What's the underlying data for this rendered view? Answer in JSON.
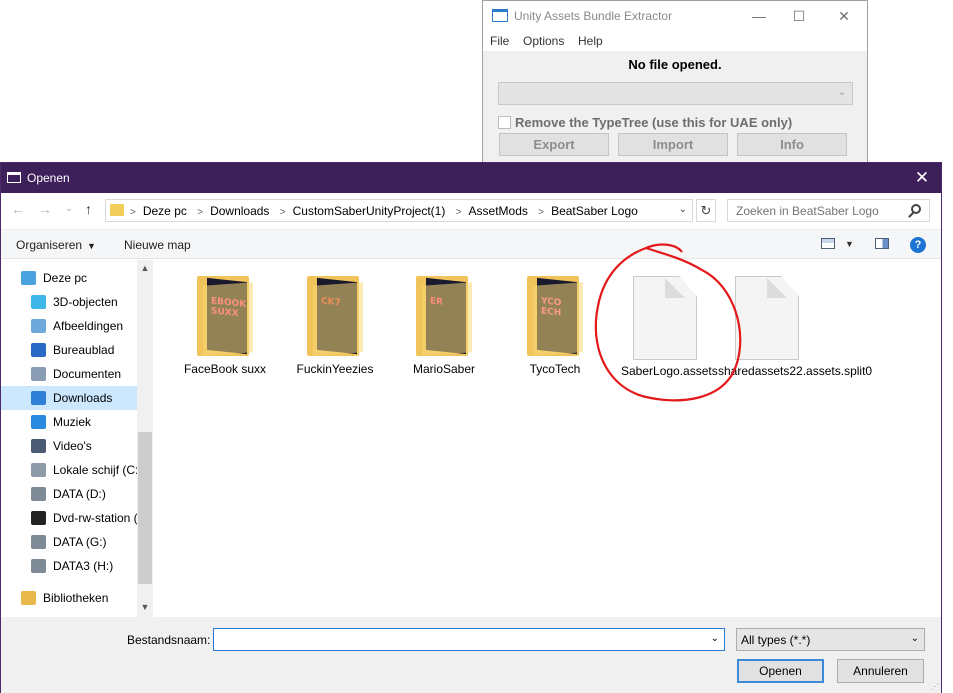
{
  "uabe": {
    "title": "Unity Assets Bundle Extractor",
    "window_controls": {
      "minimize": "—",
      "maximize": "☐",
      "close": "✕"
    },
    "menu": [
      "File",
      "Options",
      "Help"
    ],
    "status": "No file opened.",
    "remove_typetree": "Remove the TypeTree (use this for UAE only)",
    "buttons": [
      "Export",
      "Import",
      "Info"
    ]
  },
  "dialog": {
    "title": "Openen",
    "close_glyph": "✕",
    "nav": {
      "back": "←",
      "forward": "→",
      "recent": "⌄",
      "up": "↑"
    },
    "breadcrumbs": [
      "Deze pc",
      "Downloads",
      "CustomSaberUnityProject(1)",
      "AssetMods",
      "BeatSaber Logo"
    ],
    "search_placeholder": "Zoeken in BeatSaber Logo",
    "toolbar": {
      "organize": "Organiseren",
      "new_folder": "Nieuwe map",
      "help": "?"
    },
    "sidebar": [
      {
        "label": "Deze pc",
        "icon": "computer-icon",
        "color": "#4aa3df"
      },
      {
        "label": "3D-objecten",
        "icon": "cube-icon",
        "color": "#3fb6e8"
      },
      {
        "label": "Afbeeldingen",
        "icon": "pictures-icon",
        "color": "#6fa8dc"
      },
      {
        "label": "Bureaublad",
        "icon": "desktop-icon",
        "color": "#2a6ac7"
      },
      {
        "label": "Documenten",
        "icon": "documents-icon",
        "color": "#8a9db5"
      },
      {
        "label": "Downloads",
        "icon": "download-icon",
        "color": "#2f7ed8",
        "selected": true
      },
      {
        "label": "Muziek",
        "icon": "music-icon",
        "color": "#2a8ae0"
      },
      {
        "label": "Video's",
        "icon": "video-icon",
        "color": "#4a5b73"
      },
      {
        "label": "Lokale schijf (C:)",
        "icon": "drive-icon",
        "color": "#8d9aa8"
      },
      {
        "label": "DATA (D:)",
        "icon": "drive-icon",
        "color": "#7e8a96"
      },
      {
        "label": "Dvd-rw-station (",
        "icon": "dvd-icon",
        "color": "#222222"
      },
      {
        "label": "DATA (G:)",
        "icon": "drive-icon",
        "color": "#7e8a96"
      },
      {
        "label": "DATA3 (H:)",
        "icon": "drive-icon",
        "color": "#7e8a96"
      },
      {
        "label": "Bibliotheken",
        "icon": "library-icon",
        "color": "#e8b84a"
      }
    ],
    "files": [
      {
        "name": "FaceBook suxx",
        "kind": "folder",
        "poster": "EBOOK\nSUXX",
        "poster_color": "#ff3b8a"
      },
      {
        "name": "FuckinYeezies",
        "kind": "folder",
        "poster": "CK7",
        "poster_color": "#e0342f"
      },
      {
        "name": "MarioSaber",
        "kind": "folder",
        "poster": "ER",
        "poster_color": "#ff2f7a"
      },
      {
        "name": "TycoTech",
        "kind": "folder",
        "poster": "YCO\nECH",
        "poster_color": "#ff4fa0"
      },
      {
        "name": "SaberLogo.assets",
        "kind": "file"
      },
      {
        "name": "sharedassets22.assets.split0",
        "kind": "file"
      }
    ],
    "filename_label": "Bestandsnaam:",
    "filename_value": "",
    "file_type": "All types (*.*)",
    "open_button": "Openen",
    "cancel_button": "Annuleren"
  }
}
